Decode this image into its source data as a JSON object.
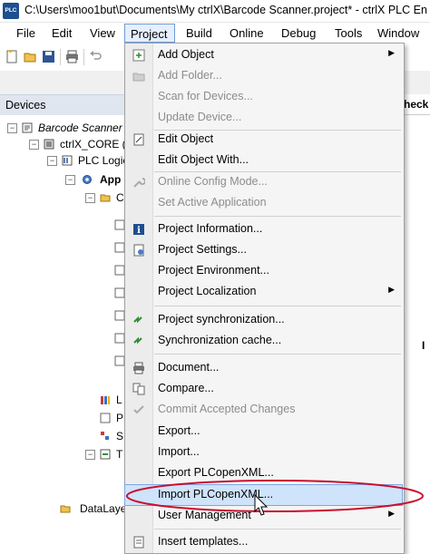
{
  "window": {
    "title": "C:\\Users\\moo1but\\Documents\\My ctrlX\\Barcode Scanner.project* - ctrlX PLC En",
    "logo_text": "PLC"
  },
  "menubar": {
    "items": [
      "File",
      "Edit",
      "View",
      "Project",
      "Build",
      "Online",
      "Debug",
      "Tools",
      "Window"
    ],
    "active": "Project"
  },
  "devices_panel": {
    "title": "Devices",
    "tree": [
      {
        "label": "Barcode Scanner",
        "italic": true
      },
      {
        "label": "ctrlX_CORE (C"
      },
      {
        "label": "PLC Logic"
      },
      {
        "label": "App",
        "bold": true
      },
      {
        "label": "DataLaye"
      }
    ],
    "partial_labels": [
      "C",
      "L",
      "P",
      "S",
      "T"
    ]
  },
  "right_panel": {
    "header": "heck",
    "marker": "I"
  },
  "project_menu": {
    "items": [
      {
        "label": "Add Object",
        "enabled": true,
        "submenu": true,
        "icon": "add-object-icon"
      },
      {
        "label": "Add Folder...",
        "enabled": false,
        "icon": "folder-icon"
      },
      {
        "label": "Scan for Devices...",
        "enabled": false
      },
      {
        "label": "Update Device...",
        "enabled": false
      },
      {
        "label": "Edit Object",
        "enabled": true,
        "icon": "edit-object-icon"
      },
      {
        "label": "Edit Object With...",
        "enabled": true
      },
      {
        "label": "Online Config Mode...",
        "enabled": false,
        "icon": "wrench-icon"
      },
      {
        "label": "Set Active Application",
        "enabled": false
      },
      {
        "label": "Project Information...",
        "enabled": true,
        "icon": "info-icon"
      },
      {
        "label": "Project Settings...",
        "enabled": true,
        "icon": "settings-icon"
      },
      {
        "label": "Project Environment...",
        "enabled": true
      },
      {
        "label": "Project Localization",
        "enabled": true,
        "submenu": true
      },
      {
        "label": "Project synchronization...",
        "enabled": true,
        "icon": "sync-icon"
      },
      {
        "label": "Synchronization cache...",
        "enabled": true,
        "icon": "sync-cache-icon"
      },
      {
        "label": "Document...",
        "enabled": true,
        "icon": "printer-icon"
      },
      {
        "label": "Compare...",
        "enabled": true,
        "icon": "compare-icon"
      },
      {
        "label": "Commit Accepted Changes",
        "enabled": false,
        "icon": "commit-icon"
      },
      {
        "label": "Export...",
        "enabled": true
      },
      {
        "label": "Import...",
        "enabled": true
      },
      {
        "label": "Export PLCopenXML...",
        "enabled": true
      },
      {
        "label": "Import PLCopenXML...",
        "enabled": true,
        "highlighted": true
      },
      {
        "label": "User Management",
        "enabled": true,
        "submenu": true
      },
      {
        "label": "Insert templates...",
        "enabled": true,
        "icon": "template-icon"
      }
    ]
  },
  "colors": {
    "menu_highlight": "#cfe3fb",
    "annotation_ellipse": "#c8102e",
    "disabled_text": "#8c8c8c",
    "devices_header": "#dfe6f0"
  }
}
